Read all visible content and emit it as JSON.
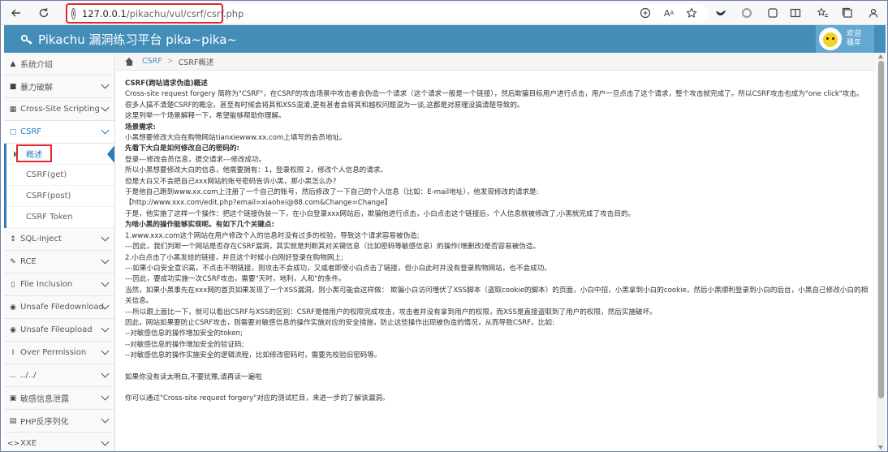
{
  "browser": {
    "url_host": "127.0.0.1",
    "url_path": "/pikachu/vul/csrf/csrf.php",
    "icons": [
      "back-icon",
      "refresh-icon",
      "site-info-icon",
      "translate-icon",
      "read-aloud-icon",
      "favorite-icon",
      "extension-bird-icon",
      "extension-circle-icon",
      "extensions-icon",
      "split-screen-icon",
      "favorites-icon",
      "collections-icon",
      "profile-icon"
    ]
  },
  "header": {
    "title": "Pikachu 漏洞练习平台 pika~pika~",
    "welcome_line1": "欢迎",
    "welcome_line2": "骚年"
  },
  "sidebar": {
    "items": [
      {
        "label": "系统介绍",
        "icon": "tag-icon"
      },
      {
        "label": "暴力破解",
        "icon": "lock-icon"
      },
      {
        "label": "Cross-Site Scripting",
        "icon": "grid-icon"
      },
      {
        "label": "CSRF",
        "icon": "fire-icon",
        "open": true
      },
      {
        "label": "SQL-Inject",
        "icon": "arrows-icon"
      },
      {
        "label": "RCE",
        "icon": "pencil-icon"
      },
      {
        "label": "File Inclusion",
        "icon": "file-icon"
      },
      {
        "label": "Unsafe Filedownload",
        "icon": "download-icon"
      },
      {
        "label": "Unsafe Fileupload",
        "icon": "upload-icon"
      },
      {
        "label": "Over Permission",
        "icon": "text-cursor-icon"
      },
      {
        "label": "../../",
        "icon": "dots-icon"
      },
      {
        "label": "敏感信息泄露",
        "icon": "camera-icon"
      },
      {
        "label": "PHP反序列化",
        "icon": "layers-icon"
      },
      {
        "label": "XXE",
        "icon": "code-icon"
      }
    ],
    "csrf_sub": [
      "概述",
      "CSRF(get)",
      "CSRF(post)",
      "CSRF Token"
    ]
  },
  "breadcrumb": {
    "link": "CSRF",
    "current": "CSRF概述"
  },
  "content": {
    "lines": [
      {
        "text": "CSRF(跨站请求伪造)概述",
        "bold": true
      },
      {
        "text": "Cross-site request forgery 简称为\"CSRF\"，在CSRF的攻击场景中攻击者会伪造一个请求（这个请求一般是一个链接），然后欺骗目标用户进行点击，用户一旦点击了这个请求，整个攻击就完成了。所以CSRF攻击也成为\"one click\"攻击。 很多人搞不清楚CSRF的概念，甚至有时候会将其和XSS混淆,更有甚者会将其和越权问题混为一谈,这都是对原理没搞清楚导致的。"
      },
      {
        "text": "这里列举一个场景解释一下，希望能够帮助你理解。"
      },
      {
        "text": "场景需求:",
        "bold": true
      },
      {
        "text": "小黑想要修改大白在购物网站tianxiewww.xx.com上填写的会员地址。"
      },
      {
        "text": "先看下大白是如何修改自己的密码的:",
        "bold": true
      },
      {
        "text": "登录---修改会员信息，提交请求---修改成功。"
      },
      {
        "text": "所以小黑想要修改大白的信息，他需要拥有：1，登录权限 2，修改个人信息的请求。"
      },
      {
        "text": "但是大白又不会把自己xxx网站的账号密码告诉小黑，那小黑怎么办?"
      },
      {
        "text": "于是他自己跑到www.xx.com上注册了一个自己的账号，然后修改了一下自己的个人信息（比如：E-mail地址），他发现修改的请求是:"
      },
      {
        "text": "【http://www.xxx.com/edit.php?email=xiaohei@88.com&Change=Change】"
      },
      {
        "text": "于是，他实施了这样一个操作：把这个链接伪装一下，在小白登录xxx网站后，欺骗他进行点击，小白点击这个链接后，个人信息就被修改了,小黑就完成了攻击目的。"
      },
      {
        "text": "为啥小黑的操作能够实现呢。有如下几个关键点:",
        "bold": true
      },
      {
        "text": "1.www.xxx.com这个网站在用户修改个人的信息时没有过多的校验，导致这个请求容易被伪造;"
      },
      {
        "text": "---因此，我们判断一个网站是否存在CSRF漏洞，其实就是判断其对关键信息（比如密码等敏感信息）的操作(增删改)是否容易被伪造。"
      },
      {
        "text": "2.小白点击了小黑发给的链接，并且这个时候小白刚好登录在购物网上;"
      },
      {
        "text": "---如果小白安全意识高，不点击不明链接，则攻击不会成功，又或者即使小白点击了链接，但小白此时并没有登录购物网站，也不会成功。"
      },
      {
        "text": "---因此，要成功实施一次CSRF攻击，需要\"天时，地利，人和\"的条件。"
      },
      {
        "text": "当然，如果小黑事先在xxx网的首页如果发现了一个XSS漏洞，则小黑可能会这样做： 欺骗小白访问埋伏了XSS脚本（盗取cookie的脚本）的页面，小白中招，小黑拿到小白的cookie，然后小黑顺利登录到小白的后台，小黑自己修改小白的相关信息。"
      },
      {
        "text": "---所以跟上面比一下，就可以看出CSRF与XSS的区别：CSRF是借用户的权限完成攻击，攻击者并没有拿到用户的权限，而XSS是直接盗取到了用户的权限，然后实施破坏。"
      },
      {
        "text": "因此，网站如果要防止CSRF攻击，则需要对敏感信息的操作实施对应的安全措施，防止这些操作出现被伪造的情况，从而导致CSRF。比如:"
      },
      {
        "text": "--对敏感信息的操作增加安全的token;"
      },
      {
        "text": "--对敏感信息的操作增加安全的验证码;"
      },
      {
        "text": "--对敏感信息的操作实施安全的逻辑流程，比如修改密码时，需要先校验旧密码等。"
      },
      {
        "text": "",
        "gap": true
      },
      {
        "text": "如果你没有读太明白,不要犹豫,请再读一遍啦"
      },
      {
        "text": "",
        "gap": true
      },
      {
        "text": "你可以通过\"Cross-site request forgery\"对应的测试栏目，来进一步的了解该漏洞。"
      }
    ]
  }
}
